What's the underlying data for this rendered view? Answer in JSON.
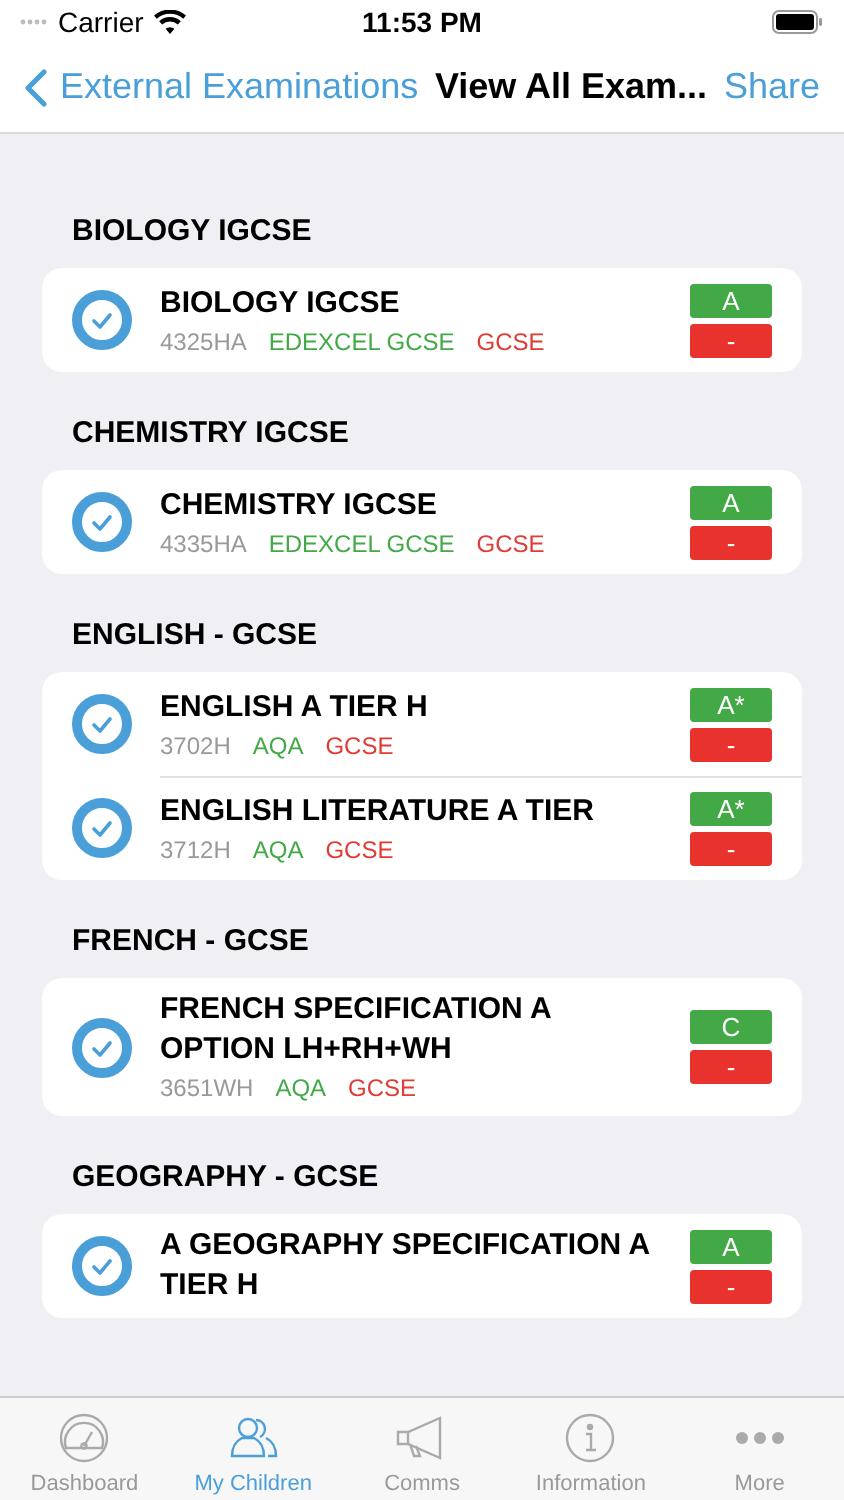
{
  "status_bar": {
    "carrier": "Carrier",
    "time": "11:53 PM"
  },
  "nav": {
    "back": "External Examinations",
    "title": "View All Exam...",
    "action": "Share"
  },
  "sections": [
    {
      "title": "BIOLOGY IGCSE",
      "exams": [
        {
          "title": "BIOLOGY IGCSE",
          "code": "4325HA",
          "board": "EDEXCEL GCSE",
          "level": "GCSE",
          "grade": "A",
          "result": "-",
          "checked": true
        }
      ]
    },
    {
      "title": "CHEMISTRY IGCSE",
      "exams": [
        {
          "title": "CHEMISTRY IGCSE",
          "code": "4335HA",
          "board": "EDEXCEL GCSE",
          "level": "GCSE",
          "grade": "A",
          "result": "-",
          "checked": true
        }
      ]
    },
    {
      "title": "ENGLISH - GCSE",
      "exams": [
        {
          "title": "ENGLISH A TIER H",
          "code": "3702H",
          "board": "AQA",
          "level": "GCSE",
          "grade": "A*",
          "result": "-",
          "checked": true
        },
        {
          "title": "ENGLISH LITERATURE A TIER",
          "code": "3712H",
          "board": "AQA",
          "level": "GCSE",
          "grade": "A*",
          "result": "-",
          "checked": true
        }
      ]
    },
    {
      "title": "FRENCH - GCSE",
      "exams": [
        {
          "title": "FRENCH SPECIFICATION A OPTION LH+RH+WH",
          "code": "3651WH",
          "board": "AQA",
          "level": "GCSE",
          "grade": "C",
          "result": "-",
          "checked": true
        }
      ]
    },
    {
      "title": "GEOGRAPHY - GCSE",
      "exams": [
        {
          "title": "A GEOGRAPHY SPECIFICATION A TIER H",
          "grade": "A",
          "result": "-",
          "checked": true
        }
      ]
    }
  ],
  "tabs": [
    {
      "label": "Dashboard",
      "selected": false
    },
    {
      "label": "My Children",
      "selected": true
    },
    {
      "label": "Comms",
      "selected": false
    },
    {
      "label": "Information",
      "selected": false
    },
    {
      "label": "More",
      "selected": false
    }
  ]
}
